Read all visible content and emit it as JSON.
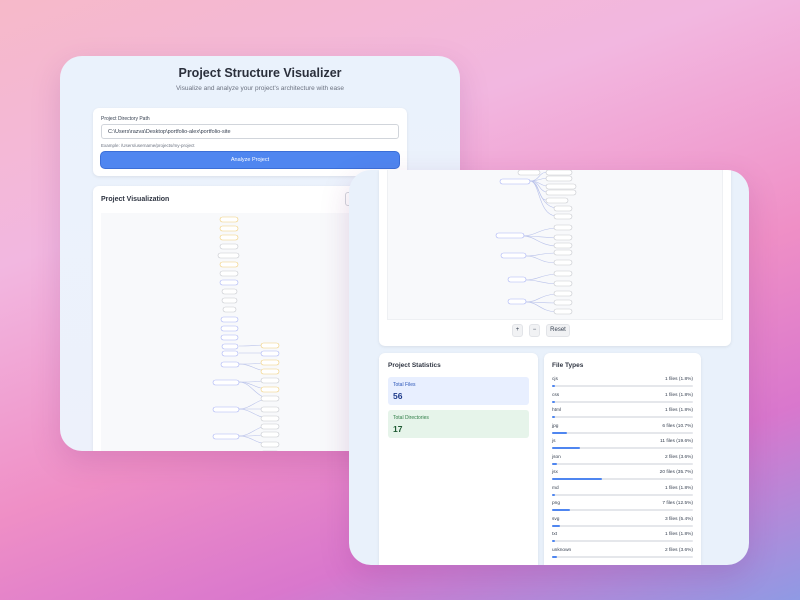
{
  "colors": {
    "accent": "#4f86f0",
    "node_border": "#c7c9ce",
    "node_dir": "#aab4f5",
    "node_yellow": "#f4d27a"
  },
  "app": {
    "title": "Project Structure Visualizer",
    "subtitle": "Visualize and analyze your project's architecture with ease"
  },
  "input": {
    "label": "Project Directory Path",
    "value": "C:\\Users\\razva\\Desktop\\portfolio-alex\\portfolio-site",
    "hint": "Example: /Users/username/projects/my-project",
    "button": "Analyze Project"
  },
  "visualization": {
    "title": "Project Visualization"
  },
  "controls": {
    "zoom_in": "+",
    "zoom_out": "−",
    "reset": "Reset"
  },
  "stats": {
    "title": "Project Statistics",
    "total_files_label": "Total Files",
    "total_files": "56",
    "total_dirs_label": "Total Directories",
    "total_dirs": "17"
  },
  "file_types": {
    "title": "File Types",
    "items": [
      {
        "ext": "cjs",
        "count": "1 files (1.8%)",
        "pct": 1.8
      },
      {
        "ext": "css",
        "count": "1 files (1.8%)",
        "pct": 1.8
      },
      {
        "ext": "html",
        "count": "1 files (1.8%)",
        "pct": 1.8
      },
      {
        "ext": "jpg",
        "count": "6 files (10.7%)",
        "pct": 10.7
      },
      {
        "ext": "js",
        "count": "11 files (19.6%)",
        "pct": 19.6
      },
      {
        "ext": "json",
        "count": "2 files (3.6%)",
        "pct": 3.6
      },
      {
        "ext": "jsx",
        "count": "20 files (35.7%)",
        "pct": 35.7
      },
      {
        "ext": "md",
        "count": "1 files (1.8%)",
        "pct": 1.8
      },
      {
        "ext": "png",
        "count": "7 files (12.5%)",
        "pct": 12.5
      },
      {
        "ext": "svg",
        "count": "3 files (5.4%)",
        "pct": 5.4
      },
      {
        "ext": "txt",
        "count": "1 files (1.8%)",
        "pct": 1.8
      },
      {
        "ext": "unknown",
        "count": "2 files (3.6%)",
        "pct": 3.6
      }
    ]
  }
}
